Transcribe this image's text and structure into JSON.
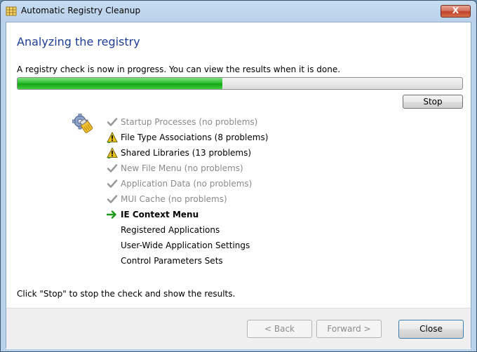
{
  "window": {
    "title": "Automatic Registry Cleanup",
    "close_glyph": "X",
    "icon": "registry-app-icon"
  },
  "page": {
    "heading": "Analyzing the registry",
    "intro": "A registry check is now in progress. You can view the results when it is done.",
    "progress": 0.46,
    "stop_label": "Stop",
    "footer_note": "Click \"Stop\" to stop the check and show the results."
  },
  "tasks": [
    {
      "label": "Startup Processes (no problems)",
      "state": "done",
      "icon": "check-icon"
    },
    {
      "label": "File Type Associations (8 problems)",
      "state": "warning",
      "icon": "warning-icon"
    },
    {
      "label": "Shared Libraries (13 problems)",
      "state": "warning",
      "icon": "warning-icon"
    },
    {
      "label": "New File Menu (no problems)",
      "state": "done",
      "icon": "check-icon"
    },
    {
      "label": "Application Data (no problems)",
      "state": "done",
      "icon": "check-icon"
    },
    {
      "label": "MUI Cache (no problems)",
      "state": "done",
      "icon": "check-icon"
    },
    {
      "label": "IE Context Menu",
      "state": "current",
      "icon": "arrow-right-icon"
    },
    {
      "label": "Registered Applications",
      "state": "pending",
      "icon": ""
    },
    {
      "label": "User-Wide Application Settings",
      "state": "pending",
      "icon": ""
    },
    {
      "label": "Control Parameters Sets",
      "state": "pending",
      "icon": ""
    }
  ],
  "buttons": {
    "back": "< Back",
    "next": "Forward >",
    "close": "Close"
  },
  "colors": {
    "heading": "#1e3c94",
    "progress_fill": "#22b022",
    "done_text": "#8a8a8a",
    "current_arrow": "#1a9a1a",
    "warning": "#e8c21a"
  }
}
